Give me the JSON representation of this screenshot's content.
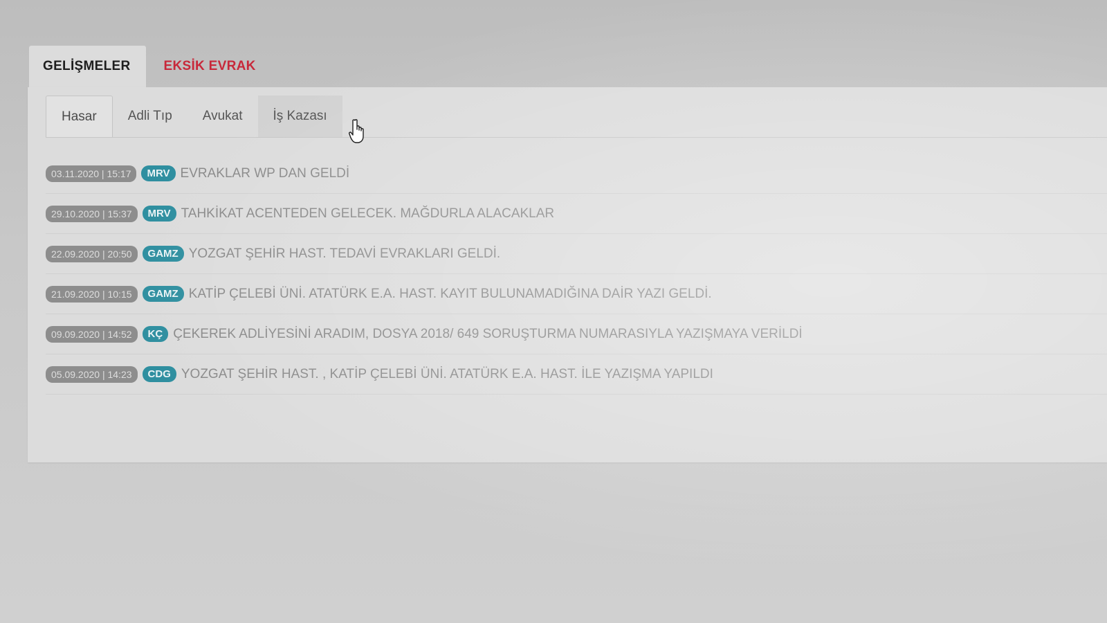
{
  "main_tabs": [
    {
      "label": "GELİŞMELER",
      "active": true
    },
    {
      "label": "EKSİK EVRAK",
      "active": false,
      "color": "#c8283a"
    }
  ],
  "sub_tabs": [
    {
      "label": "Hasar",
      "active": true
    },
    {
      "label": "Adli Tıp",
      "active": false
    },
    {
      "label": "Avukat",
      "active": false
    },
    {
      "label": "İş Kazası",
      "active": false,
      "hovered": true
    }
  ],
  "cursor": {
    "icon": "hand-pointer-icon"
  },
  "entries": [
    {
      "date": "03.11.2020 | 15:17",
      "user": "MRV",
      "text": "EVRAKLAR WP DAN GELDİ"
    },
    {
      "date": "29.10.2020 | 15:37",
      "user": "MRV",
      "text": "TAHKİKAT ACENTEDEN GELECEK. MAĞDURLA ALACAKLAR"
    },
    {
      "date": "22.09.2020 | 20:50",
      "user": "GAMZ",
      "text": "YOZGAT ŞEHİR HAST. TEDAVİ EVRAKLARI GELDİ."
    },
    {
      "date": "21.09.2020 | 10:15",
      "user": "GAMZ",
      "text": "KATİP ÇELEBİ ÜNİ. ATATÜRK E.A. HAST. KAYIT BULUNAMADIĞINA DAİR YAZI GELDİ."
    },
    {
      "date": "09.09.2020 | 14:52",
      "user": "KÇ",
      "text": "ÇEKEREK ADLİYESİNİ ARADIM, DOSYA 2018/ 649 SORUŞTURMA NUMARASIYLA YAZIŞMAYA VERİLDİ"
    },
    {
      "date": "05.09.2020 | 14:23",
      "user": "CDG",
      "text": "YOZGAT ŞEHİR HAST. , KATİP ÇELEBİ ÜNİ. ATATÜRK E.A. HAST. İLE YAZIŞMA YAPILDI"
    }
  ],
  "colors": {
    "date_badge": "#8d8d8d",
    "user_badge": "#2f8fa0",
    "alert_tab": "#c8283a"
  }
}
